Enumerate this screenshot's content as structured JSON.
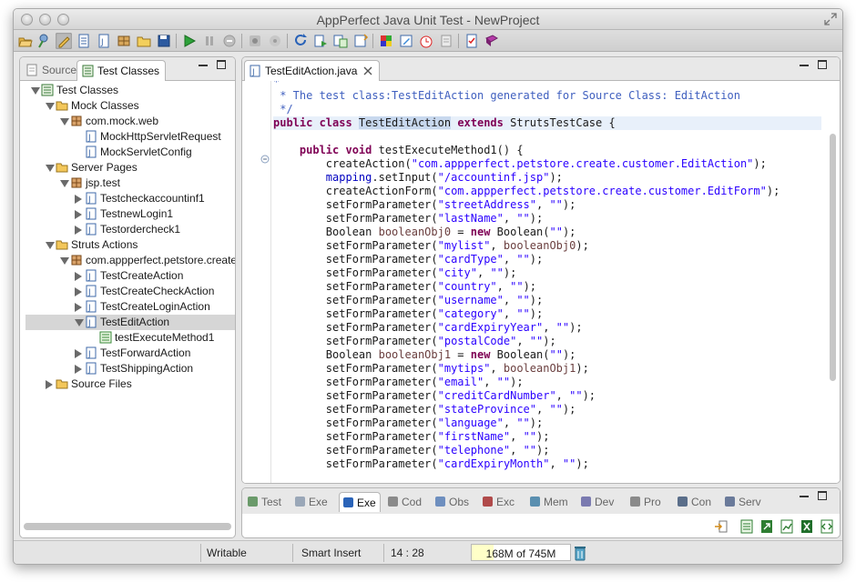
{
  "window": {
    "title": "AppPerfect Java Unit Test - NewProject"
  },
  "toolbar": {
    "icons": [
      "open-project-icon",
      "wizard-icon",
      "edit-icon",
      "new-file-icon",
      "new-class-icon",
      "new-package-icon",
      "open-folder-icon",
      "save-icon",
      "run-icon",
      "pause-icon",
      "stop-icon",
      "record-icon",
      "record-disabled-icon",
      "refresh-icon",
      "generate-icon",
      "test-data-icon",
      "test-suite-icon",
      "build-icon",
      "edit-test-icon",
      "timer-icon",
      "log-icon",
      "report-icon",
      "help-book-icon"
    ]
  },
  "left_panel": {
    "tabs": [
      {
        "label": "Source",
        "active": false
      },
      {
        "label": "Test Classes",
        "active": true
      }
    ],
    "tree": [
      {
        "label": "Test Classes",
        "level": 0,
        "arrow": "down",
        "icon": "test-classes-icon"
      },
      {
        "label": "Mock Classes",
        "level": 1,
        "arrow": "down",
        "icon": "folder-icon"
      },
      {
        "label": "com.mock.web",
        "level": 2,
        "arrow": "down",
        "icon": "package-icon"
      },
      {
        "label": "MockHttpServletRequest",
        "level": 3,
        "arrow": "none",
        "icon": "java-file-icon"
      },
      {
        "label": "MockServletConfig",
        "level": 3,
        "arrow": "none",
        "icon": "java-file-icon"
      },
      {
        "label": "Server Pages",
        "level": 1,
        "arrow": "down",
        "icon": "folder-icon"
      },
      {
        "label": "jsp.test",
        "level": 2,
        "arrow": "down",
        "icon": "package-icon"
      },
      {
        "label": "Testcheckaccountinf1",
        "level": 3,
        "arrow": "right",
        "icon": "java-file-icon"
      },
      {
        "label": "TestnewLogin1",
        "level": 3,
        "arrow": "right",
        "icon": "java-file-icon"
      },
      {
        "label": "Testordercheck1",
        "level": 3,
        "arrow": "right",
        "icon": "java-file-icon"
      },
      {
        "label": "Struts Actions",
        "level": 1,
        "arrow": "down",
        "icon": "folder-icon"
      },
      {
        "label": "com.appperfect.petstore.create",
        "level": 2,
        "arrow": "down",
        "icon": "package-icon"
      },
      {
        "label": "TestCreateAction",
        "level": 3,
        "arrow": "right",
        "icon": "java-file-icon"
      },
      {
        "label": "TestCreateCheckAction",
        "level": 3,
        "arrow": "right",
        "icon": "java-file-icon"
      },
      {
        "label": "TestCreateLoginAction",
        "level": 3,
        "arrow": "right",
        "icon": "java-file-icon"
      },
      {
        "label": "TestEditAction",
        "level": 3,
        "arrow": "down",
        "icon": "java-file-icon",
        "selected": true
      },
      {
        "label": "testExecuteMethod1",
        "level": 4,
        "arrow": "none",
        "icon": "method-icon"
      },
      {
        "label": "TestForwardAction",
        "level": 3,
        "arrow": "right",
        "icon": "java-file-icon"
      },
      {
        "label": "TestShippingAction",
        "level": 3,
        "arrow": "right",
        "icon": "java-file-icon"
      },
      {
        "label": "Source Files",
        "level": 1,
        "arrow": "right",
        "icon": "folder-icon"
      }
    ]
  },
  "editor": {
    "tab_label": "TestEditAction.java",
    "lines": [
      [
        {
          "t": "*",
          "c": "cm"
        }
      ],
      [
        {
          "t": " * The test class:TestEditAction generated for Source Class: EditAction",
          "c": "cm"
        }
      ],
      [
        {
          "t": " */",
          "c": "cm"
        }
      ],
      [
        {
          "t": "public class ",
          "c": "kw"
        },
        {
          "t": "TestEditAction",
          "c": "sel-word"
        },
        {
          "t": " "
        },
        {
          "t": "extends",
          "c": "kw"
        },
        {
          "t": " StrutsTestCase {"
        }
      ],
      [
        {
          "t": ""
        }
      ],
      [
        {
          "t": "    "
        },
        {
          "t": "public void",
          "c": "kw"
        },
        {
          "t": " testExecuteMethod1() {"
        }
      ],
      [
        {
          "t": "        createAction("
        },
        {
          "t": "\"com.appperfect.petstore.create.customer.EditAction\"",
          "c": "str"
        },
        {
          "t": ");"
        }
      ],
      [
        {
          "t": "        "
        },
        {
          "t": "mapping",
          "c": "fld"
        },
        {
          "t": ".setInput("
        },
        {
          "t": "\"/accountinf.jsp\"",
          "c": "str"
        },
        {
          "t": ");"
        }
      ],
      [
        {
          "t": "        createActionForm("
        },
        {
          "t": "\"com.appperfect.petstore.create.customer.EditForm\"",
          "c": "str"
        },
        {
          "t": ");"
        }
      ],
      [
        {
          "t": "        setFormParameter("
        },
        {
          "t": "\"streetAddress\"",
          "c": "str"
        },
        {
          "t": ", "
        },
        {
          "t": "\"\"",
          "c": "str"
        },
        {
          "t": ");"
        }
      ],
      [
        {
          "t": "        setFormParameter("
        },
        {
          "t": "\"lastName\"",
          "c": "str"
        },
        {
          "t": ", "
        },
        {
          "t": "\"\"",
          "c": "str"
        },
        {
          "t": ");"
        }
      ],
      [
        {
          "t": "        Boolean "
        },
        {
          "t": "booleanObj0",
          "c": "loc"
        },
        {
          "t": " = "
        },
        {
          "t": "new",
          "c": "kw"
        },
        {
          "t": " Boolean("
        },
        {
          "t": "\"\"",
          "c": "str"
        },
        {
          "t": ");"
        }
      ],
      [
        {
          "t": "        setFormParameter("
        },
        {
          "t": "\"mylist\"",
          "c": "str"
        },
        {
          "t": ", "
        },
        {
          "t": "booleanObj0",
          "c": "loc"
        },
        {
          "t": ");"
        }
      ],
      [
        {
          "t": "        setFormParameter("
        },
        {
          "t": "\"cardType\"",
          "c": "str"
        },
        {
          "t": ", "
        },
        {
          "t": "\"\"",
          "c": "str"
        },
        {
          "t": ");"
        }
      ],
      [
        {
          "t": "        setFormParameter("
        },
        {
          "t": "\"city\"",
          "c": "str"
        },
        {
          "t": ", "
        },
        {
          "t": "\"\"",
          "c": "str"
        },
        {
          "t": ");"
        }
      ],
      [
        {
          "t": "        setFormParameter("
        },
        {
          "t": "\"country\"",
          "c": "str"
        },
        {
          "t": ", "
        },
        {
          "t": "\"\"",
          "c": "str"
        },
        {
          "t": ");"
        }
      ],
      [
        {
          "t": "        setFormParameter("
        },
        {
          "t": "\"username\"",
          "c": "str"
        },
        {
          "t": ", "
        },
        {
          "t": "\"\"",
          "c": "str"
        },
        {
          "t": ");"
        }
      ],
      [
        {
          "t": "        setFormParameter("
        },
        {
          "t": "\"category\"",
          "c": "str"
        },
        {
          "t": ", "
        },
        {
          "t": "\"\"",
          "c": "str"
        },
        {
          "t": ");"
        }
      ],
      [
        {
          "t": "        setFormParameter("
        },
        {
          "t": "\"cardExpiryYear\"",
          "c": "str"
        },
        {
          "t": ", "
        },
        {
          "t": "\"\"",
          "c": "str"
        },
        {
          "t": ");"
        }
      ],
      [
        {
          "t": "        setFormParameter("
        },
        {
          "t": "\"postalCode\"",
          "c": "str"
        },
        {
          "t": ", "
        },
        {
          "t": "\"\"",
          "c": "str"
        },
        {
          "t": ");"
        }
      ],
      [
        {
          "t": "        Boolean "
        },
        {
          "t": "booleanObj1",
          "c": "loc"
        },
        {
          "t": " = "
        },
        {
          "t": "new",
          "c": "kw"
        },
        {
          "t": " Boolean("
        },
        {
          "t": "\"\"",
          "c": "str"
        },
        {
          "t": ");"
        }
      ],
      [
        {
          "t": "        setFormParameter("
        },
        {
          "t": "\"mytips\"",
          "c": "str"
        },
        {
          "t": ", "
        },
        {
          "t": "booleanObj1",
          "c": "loc"
        },
        {
          "t": ");"
        }
      ],
      [
        {
          "t": "        setFormParameter("
        },
        {
          "t": "\"email\"",
          "c": "str"
        },
        {
          "t": ", "
        },
        {
          "t": "\"\"",
          "c": "str"
        },
        {
          "t": ");"
        }
      ],
      [
        {
          "t": "        setFormParameter("
        },
        {
          "t": "\"creditCardNumber\"",
          "c": "str"
        },
        {
          "t": ", "
        },
        {
          "t": "\"\"",
          "c": "str"
        },
        {
          "t": ");"
        }
      ],
      [
        {
          "t": "        setFormParameter("
        },
        {
          "t": "\"stateProvince\"",
          "c": "str"
        },
        {
          "t": ", "
        },
        {
          "t": "\"\"",
          "c": "str"
        },
        {
          "t": ");"
        }
      ],
      [
        {
          "t": "        setFormParameter("
        },
        {
          "t": "\"language\"",
          "c": "str"
        },
        {
          "t": ", "
        },
        {
          "t": "\"\"",
          "c": "str"
        },
        {
          "t": ");"
        }
      ],
      [
        {
          "t": "        setFormParameter("
        },
        {
          "t": "\"firstName\"",
          "c": "str"
        },
        {
          "t": ", "
        },
        {
          "t": "\"\"",
          "c": "str"
        },
        {
          "t": ");"
        }
      ],
      [
        {
          "t": "        setFormParameter("
        },
        {
          "t": "\"telephone\"",
          "c": "str"
        },
        {
          "t": ", "
        },
        {
          "t": "\"\"",
          "c": "str"
        },
        {
          "t": ");"
        }
      ],
      [
        {
          "t": "        setFormParameter("
        },
        {
          "t": "\"cardExpiryMonth\"",
          "c": "str"
        },
        {
          "t": ", "
        },
        {
          "t": "\"\"",
          "c": "str"
        },
        {
          "t": ");"
        }
      ]
    ]
  },
  "bottom_panel": {
    "tabs": [
      {
        "label": "Test",
        "icon": "test-view-icon",
        "active": false
      },
      {
        "label": "Exe",
        "icon": "execution-icon",
        "active": false
      },
      {
        "label": "Exe",
        "icon": "execution-info-icon",
        "active": true
      },
      {
        "label": "Cod",
        "icon": "code-icon",
        "active": false
      },
      {
        "label": "Obs",
        "icon": "observer-icon",
        "active": false
      },
      {
        "label": "Exc",
        "icon": "exception-icon",
        "active": false
      },
      {
        "label": "Mem",
        "icon": "memory-icon",
        "active": false
      },
      {
        "label": "Dev",
        "icon": "developer-icon",
        "active": false
      },
      {
        "label": "Pro",
        "icon": "properties-icon",
        "active": false
      },
      {
        "label": "Con",
        "icon": "console-icon",
        "active": false
      },
      {
        "label": "Serv",
        "icon": "server-icon",
        "active": false
      }
    ],
    "action_icons": [
      "import-icon",
      "sheet-icon",
      "export-sheet-icon",
      "export-chart-icon",
      "excel-icon",
      "xml-icon"
    ]
  },
  "status": {
    "mode": "Writable",
    "insert": "Smart Insert",
    "position": "14 : 28",
    "heap": "168M of 745M",
    "heap_used_fraction": 0.225
  }
}
